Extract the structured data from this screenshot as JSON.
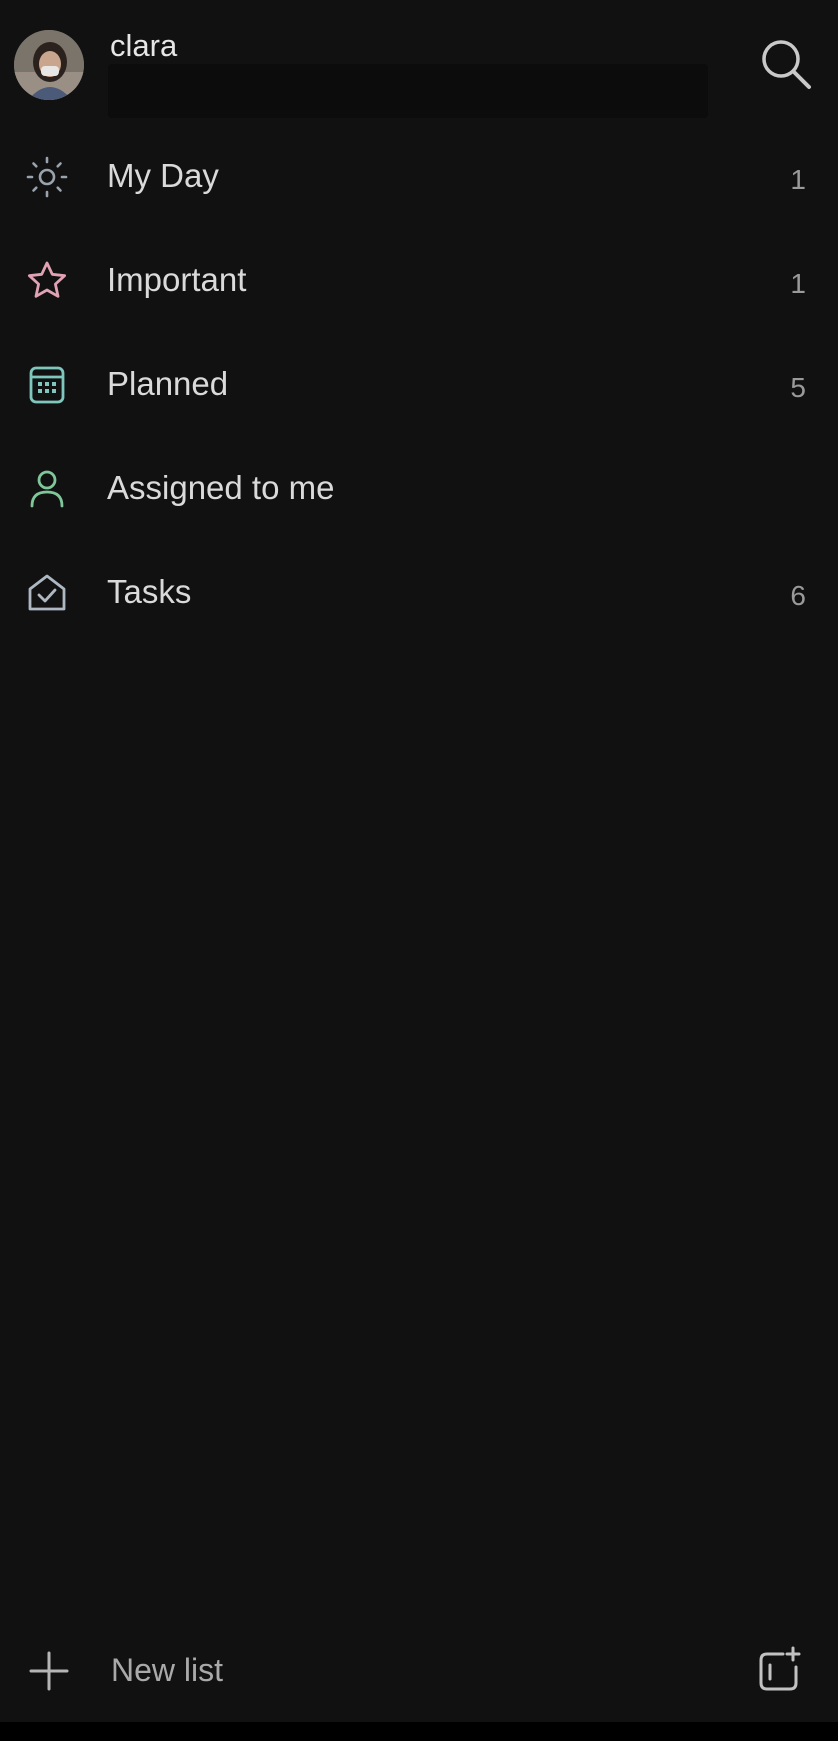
{
  "header": {
    "username": "clara"
  },
  "nav": {
    "items": [
      {
        "label": "My Day",
        "count": "1",
        "icon": "sun-icon",
        "color": "#9aa3ad"
      },
      {
        "label": "Important",
        "count": "1",
        "icon": "star-icon",
        "color": "#e0a3b4"
      },
      {
        "label": "Planned",
        "count": "5",
        "icon": "calendar-icon",
        "color": "#7fc7bd"
      },
      {
        "label": "Assigned to me",
        "count": "",
        "icon": "person-icon",
        "color": "#7fc79a"
      },
      {
        "label": "Tasks",
        "count": "6",
        "icon": "home-check-icon",
        "color": "#aeb8c2"
      }
    ]
  },
  "footer": {
    "new_list_label": "New list"
  },
  "colors": {
    "background": "#111111",
    "text": "#dadada",
    "muted": "#9a9a9a"
  }
}
